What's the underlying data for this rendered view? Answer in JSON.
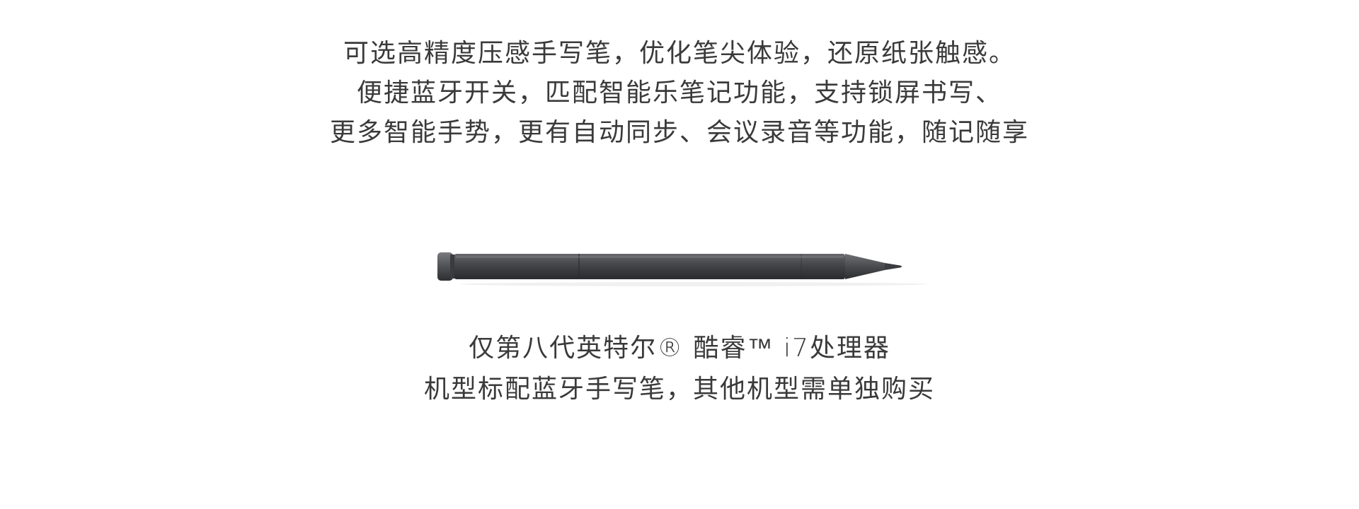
{
  "intro": {
    "lines": [
      "可选高精度压感手写笔，优化笔尖体验，还原纸张触感。",
      "便捷蓝牙开关，匹配智能乐笔记功能，支持锁屏书写、",
      "更多智能手势，更有自动同步、会议录音等功能，随记随享"
    ]
  },
  "product": {
    "image": "stylus-pen",
    "color": "#4a4b4d"
  },
  "caption": {
    "lines": [
      "仅第八代英特尔® 酷睿™ i7处理器",
      "机型标配蓝牙手写笔，其他机型需单独购买"
    ]
  }
}
